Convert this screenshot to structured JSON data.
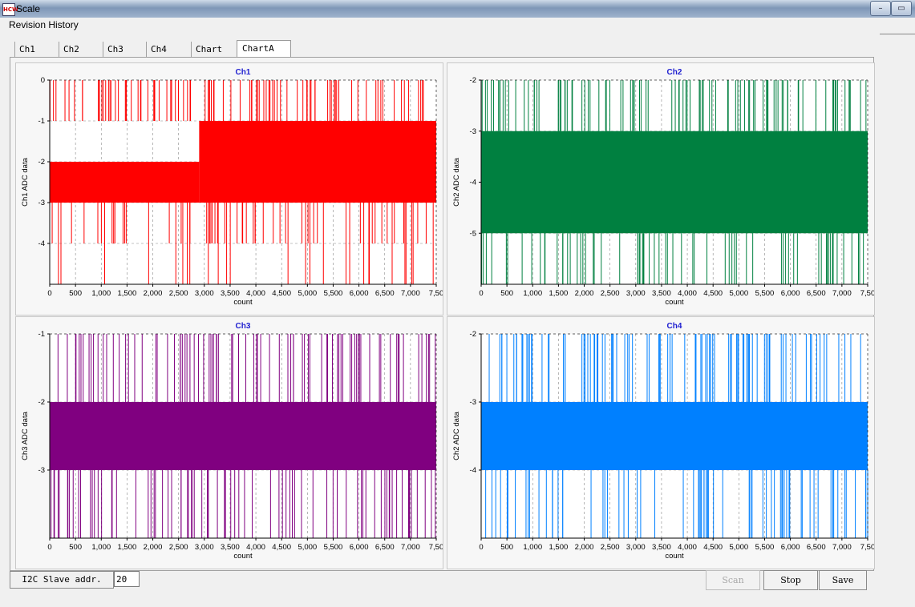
{
  "window": {
    "title": "Scale",
    "icon": "app-icon",
    "icon_text": "HCW"
  },
  "menu": {
    "items": [
      "Revision History"
    ]
  },
  "tabs": [
    "Ch1",
    "Ch2",
    "Ch3",
    "Ch4",
    "Chart",
    "ChartA"
  ],
  "active_tab": "Chart",
  "footer": {
    "slave_label": "I2C Slave addr.",
    "slave_value": "20",
    "scan_label": "Scan",
    "stop_label": "Stop",
    "save_label": "Save"
  },
  "chart_data": [
    {
      "type": "line",
      "title": "Ch1",
      "xlabel": "count",
      "ylabel": "Ch1 ADC data",
      "color": "#ff0000",
      "xlim": [
        0,
        7500
      ],
      "ylim": [
        -5,
        0
      ],
      "yticks": [
        0,
        -1,
        -2,
        -3,
        -4
      ],
      "xticks": [
        "0",
        "500",
        "1,000",
        "1,500",
        "2,000",
        "2,500",
        "3,000",
        "3,500",
        "4,000",
        "4,500",
        "5,000",
        "5,500",
        "6,000",
        "6,500",
        "7,000",
        "7,50"
      ],
      "band_ranges": [
        {
          "x": [
            0,
            2900
          ],
          "y": [
            -2,
            -3
          ]
        },
        {
          "x": [
            2900,
            7500
          ],
          "y": [
            -1,
            -3
          ]
        }
      ],
      "spike_levels": [
        0,
        -4,
        -5
      ]
    },
    {
      "type": "line",
      "title": "Ch2",
      "xlabel": "count",
      "ylabel": "Ch2 ADC data",
      "color": "#008040",
      "xlim": [
        0,
        7500
      ],
      "ylim": [
        -6,
        -2
      ],
      "yticks": [
        -2,
        -3,
        -4,
        -5
      ],
      "xticks": [
        "0",
        "500",
        "1,000",
        "1,500",
        "2,000",
        "2,500",
        "3,000",
        "3,500",
        "4,000",
        "4,500",
        "5,000",
        "5,500",
        "6,000",
        "6,500",
        "7,000",
        "7,50"
      ],
      "band_ranges": [
        {
          "x": [
            0,
            7500
          ],
          "y": [
            -4,
            -5
          ]
        },
        {
          "x": [
            0,
            7500
          ],
          "y": [
            -3,
            -4
          ]
        }
      ],
      "spike_levels": [
        -2,
        -6
      ]
    },
    {
      "type": "line",
      "title": "Ch3",
      "xlabel": "count",
      "ylabel": "Ch3 ADC data",
      "color": "#800080",
      "xlim": [
        0,
        7500
      ],
      "ylim": [
        -4,
        -1
      ],
      "yticks": [
        -1,
        -2,
        -3
      ],
      "xticks": [
        "0",
        "500",
        "1,000",
        "1,500",
        "2,000",
        "2,500",
        "3,000",
        "3,500",
        "4,000",
        "4,500",
        "5,000",
        "5,500",
        "6,000",
        "6,500",
        "7,000",
        "7,50"
      ],
      "band_ranges": [
        {
          "x": [
            0,
            7500
          ],
          "y": [
            -2,
            -3
          ]
        }
      ],
      "spike_levels": [
        -1,
        -4
      ]
    },
    {
      "type": "line",
      "title": "Ch4",
      "xlabel": "count",
      "ylabel": "Ch2 ADC data",
      "color": "#0080ff",
      "xlim": [
        0,
        7500
      ],
      "ylim": [
        -5,
        -2
      ],
      "yticks": [
        -2,
        -3,
        -4
      ],
      "xticks": [
        "0",
        "500",
        "1,000",
        "1,500",
        "2,000",
        "2,500",
        "3,000",
        "3,500",
        "4,000",
        "4,500",
        "5,000",
        "5,500",
        "6,000",
        "6,500",
        "7,000",
        "7,50"
      ],
      "band_ranges": [
        {
          "x": [
            0,
            7500
          ],
          "y": [
            -3,
            -4
          ]
        }
      ],
      "spike_levels": [
        -2,
        -5
      ]
    }
  ]
}
